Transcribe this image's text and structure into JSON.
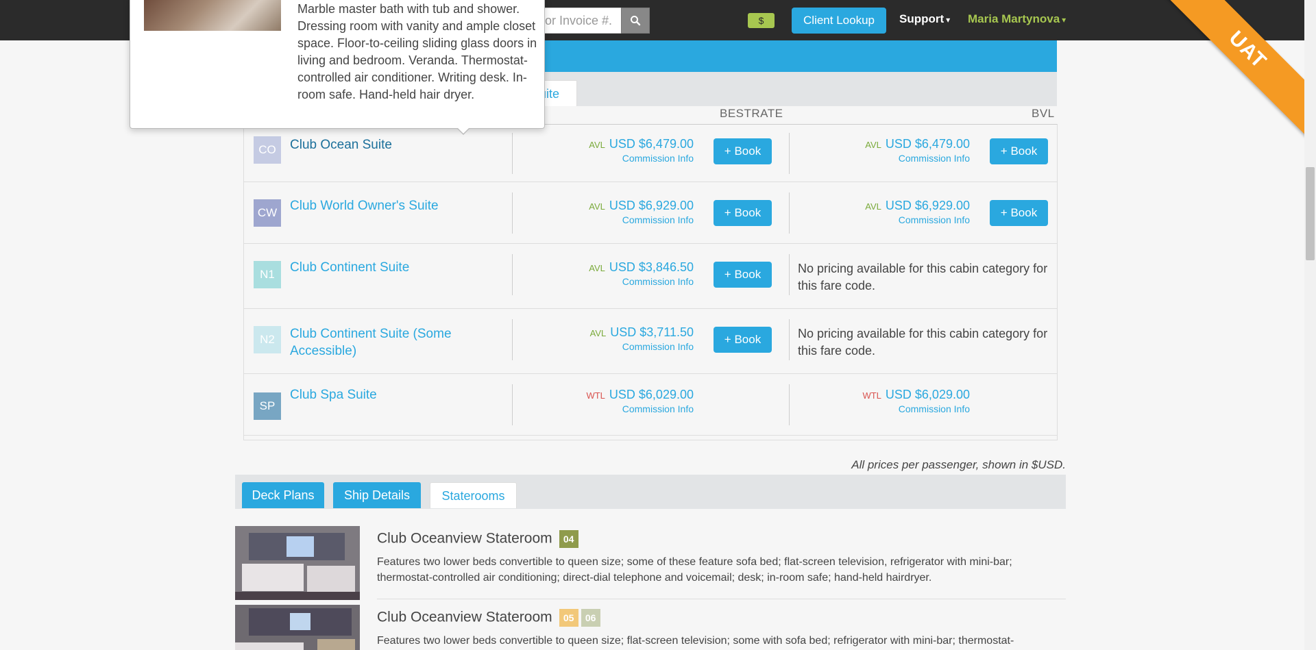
{
  "navbar": {
    "search_placeholder": "or Invoice #.",
    "dollar_badge": "$",
    "client_lookup": "Client Lookup",
    "support": "Support",
    "user_name": "Maria Martynova",
    "chevron": "⌄"
  },
  "ribbon": {
    "label": "UAT"
  },
  "tabs": {
    "suite_tab": "uite"
  },
  "columns": {
    "bestrate": "BESTRATE",
    "bvl": "BVL"
  },
  "popover": {
    "text": "Marble master bath with tub and shower. Dressing room with vanity and ample closet space. Floor-to-ceiling sliding glass doors in living and bedroom. Veranda. Thermostat-controlled air conditioner. Writing desk. In-room safe. Hand-held hair dryer."
  },
  "cabins": [
    {
      "code": "CO",
      "color": "#c5cbe3",
      "name": "Club Ocean Suite",
      "best": {
        "status": "AVL",
        "price": "USD $6,479.00",
        "commission": "Commission Info",
        "book": "+ Book"
      },
      "bvl": {
        "status": "AVL",
        "price": "USD $6,479.00",
        "commission": "Commission Info",
        "book": "+ Book"
      }
    },
    {
      "code": "CW",
      "color": "#9ea6cf",
      "name": "Club World Owner's Suite",
      "best": {
        "status": "AVL",
        "price": "USD $6,929.00",
        "commission": "Commission Info",
        "book": "+ Book"
      },
      "bvl": {
        "status": "AVL",
        "price": "USD $6,929.00",
        "commission": "Commission Info",
        "book": "+ Book"
      }
    },
    {
      "code": "N1",
      "color": "#a9dedf",
      "name": "Club Continent Suite",
      "best": {
        "status": "AVL",
        "price": "USD $3,846.50",
        "commission": "Commission Info",
        "book": "+ Book"
      },
      "bvl_message": "No pricing available for this cabin category for this fare code."
    },
    {
      "code": "N2",
      "color": "#cbe8ee",
      "name": "Club Continent Suite (Some Accessible)",
      "best": {
        "status": "AVL",
        "price": "USD $3,711.50",
        "commission": "Commission Info",
        "book": "+ Book"
      },
      "bvl_message": "No pricing available for this cabin category for this fare code."
    },
    {
      "code": "SP",
      "color": "#78a6c3",
      "name": "Club Spa Suite",
      "best": {
        "status": "WTL",
        "price": "USD $6,029.00",
        "commission": "Commission Info"
      },
      "bvl": {
        "status": "WTL",
        "price": "USD $6,029.00",
        "commission": "Commission Info"
      }
    }
  ],
  "prices_note": "All prices per passenger, shown in $USD.",
  "bottom_tabs": {
    "deck_plans": "Deck Plans",
    "ship_details": "Ship Details",
    "staterooms": "Staterooms"
  },
  "staterooms": [
    {
      "title": "Club Oceanview Stateroom",
      "badges": [
        {
          "label": "04",
          "color": "#8f9b4c"
        }
      ],
      "description": "Features two lower beds convertible to queen size; some of these feature sofa bed; flat-screen television, refrigerator with mini-bar; thermostat-controlled air conditioning; direct-dial telephone and voicemail; desk; in-room safe; hand-held hairdryer."
    },
    {
      "title": "Club Oceanview Stateroom",
      "badges": [
        {
          "label": "05",
          "color": "#f2c879"
        },
        {
          "label": "06",
          "color": "#c9cfb2"
        }
      ],
      "description": "Features two lower beds convertible to queen size; flat-screen television; some with sofa bed; refrigerator with mini-bar; thermostat-"
    }
  ],
  "colors": {
    "accent": "#2aa8df",
    "navbar": "#2b2b2b",
    "ribbon": "#f59a23",
    "avl": "#7aaa3a",
    "wtl": "#d9534f"
  }
}
